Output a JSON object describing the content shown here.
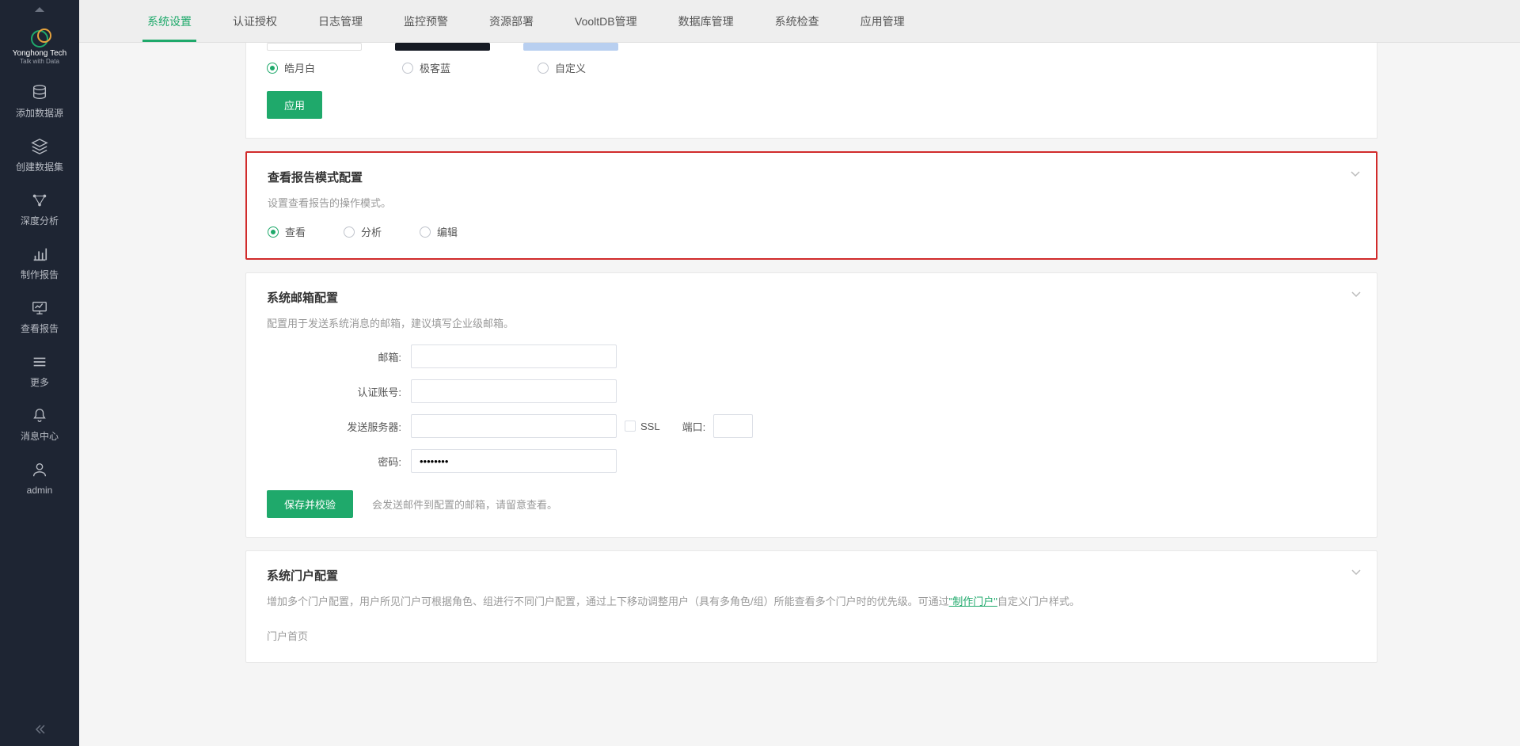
{
  "brand": {
    "name": "Yonghong Tech",
    "sub": "Talk with Data"
  },
  "sidebar": {
    "items": [
      {
        "label": "添加数据源"
      },
      {
        "label": "创建数据集"
      },
      {
        "label": "深度分析"
      },
      {
        "label": "制作报告"
      },
      {
        "label": "查看报告"
      },
      {
        "label": "更多"
      },
      {
        "label": "消息中心"
      },
      {
        "label": "admin"
      }
    ]
  },
  "tabs": [
    {
      "label": "系统设置",
      "active": true
    },
    {
      "label": "认证授权"
    },
    {
      "label": "日志管理"
    },
    {
      "label": "监控预警"
    },
    {
      "label": "资源部署"
    },
    {
      "label": "VooltDB管理"
    },
    {
      "label": "数据库管理"
    },
    {
      "label": "系统检查"
    },
    {
      "label": "应用管理"
    }
  ],
  "theme": {
    "options": [
      {
        "label": "皓月白",
        "checked": true
      },
      {
        "label": "极客蓝",
        "checked": false
      },
      {
        "label": "自定义",
        "checked": false
      }
    ],
    "apply": "应用"
  },
  "viewMode": {
    "title": "查看报告模式配置",
    "desc": "设置查看报告的操作模式。",
    "options": [
      {
        "label": "查看",
        "checked": true
      },
      {
        "label": "分析",
        "checked": false
      },
      {
        "label": "编辑",
        "checked": false
      }
    ]
  },
  "email": {
    "title": "系统邮箱配置",
    "desc": "配置用于发送系统消息的邮箱，建议填写企业级邮箱。",
    "labels": {
      "mailbox": "邮箱:",
      "account": "认证账号:",
      "smtp": "发送服务器:",
      "ssl": "SSL",
      "port": "端口:",
      "password": "密码:"
    },
    "values": {
      "mailbox": "",
      "account": "",
      "smtp": "",
      "port": "",
      "password": "••••••••"
    },
    "save": "保存并校验",
    "hint": "会发送邮件到配置的邮箱，请留意查看。"
  },
  "portal": {
    "title": "系统门户配置",
    "desc_pre": "增加多个门户配置，用户所见门户可根据角色、组进行不同门户配置，通过上下移动调整用户（具有多角色/组）所能查看多个门户时的优先级。可通过",
    "desc_link": "\"制作门户\"",
    "desc_post": "自定义门户样式。",
    "home": "门户首页"
  }
}
